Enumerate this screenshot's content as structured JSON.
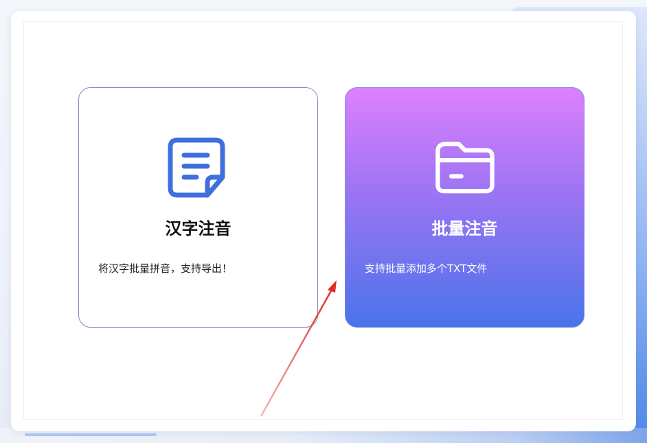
{
  "cards": [
    {
      "title": "汉字注音",
      "description": "将汉字批量拼音，支持导出！",
      "icon": "document-icon",
      "icon_color": "#3f6fdf"
    },
    {
      "title": "批量注音",
      "description": "支持批量添加多个TXT文件",
      "icon": "folder-icon",
      "gradient": [
        "#dd80fd",
        "#9a74f3",
        "#4a74ea"
      ]
    }
  ],
  "annotation": {
    "arrow_color": "#e02a24"
  }
}
